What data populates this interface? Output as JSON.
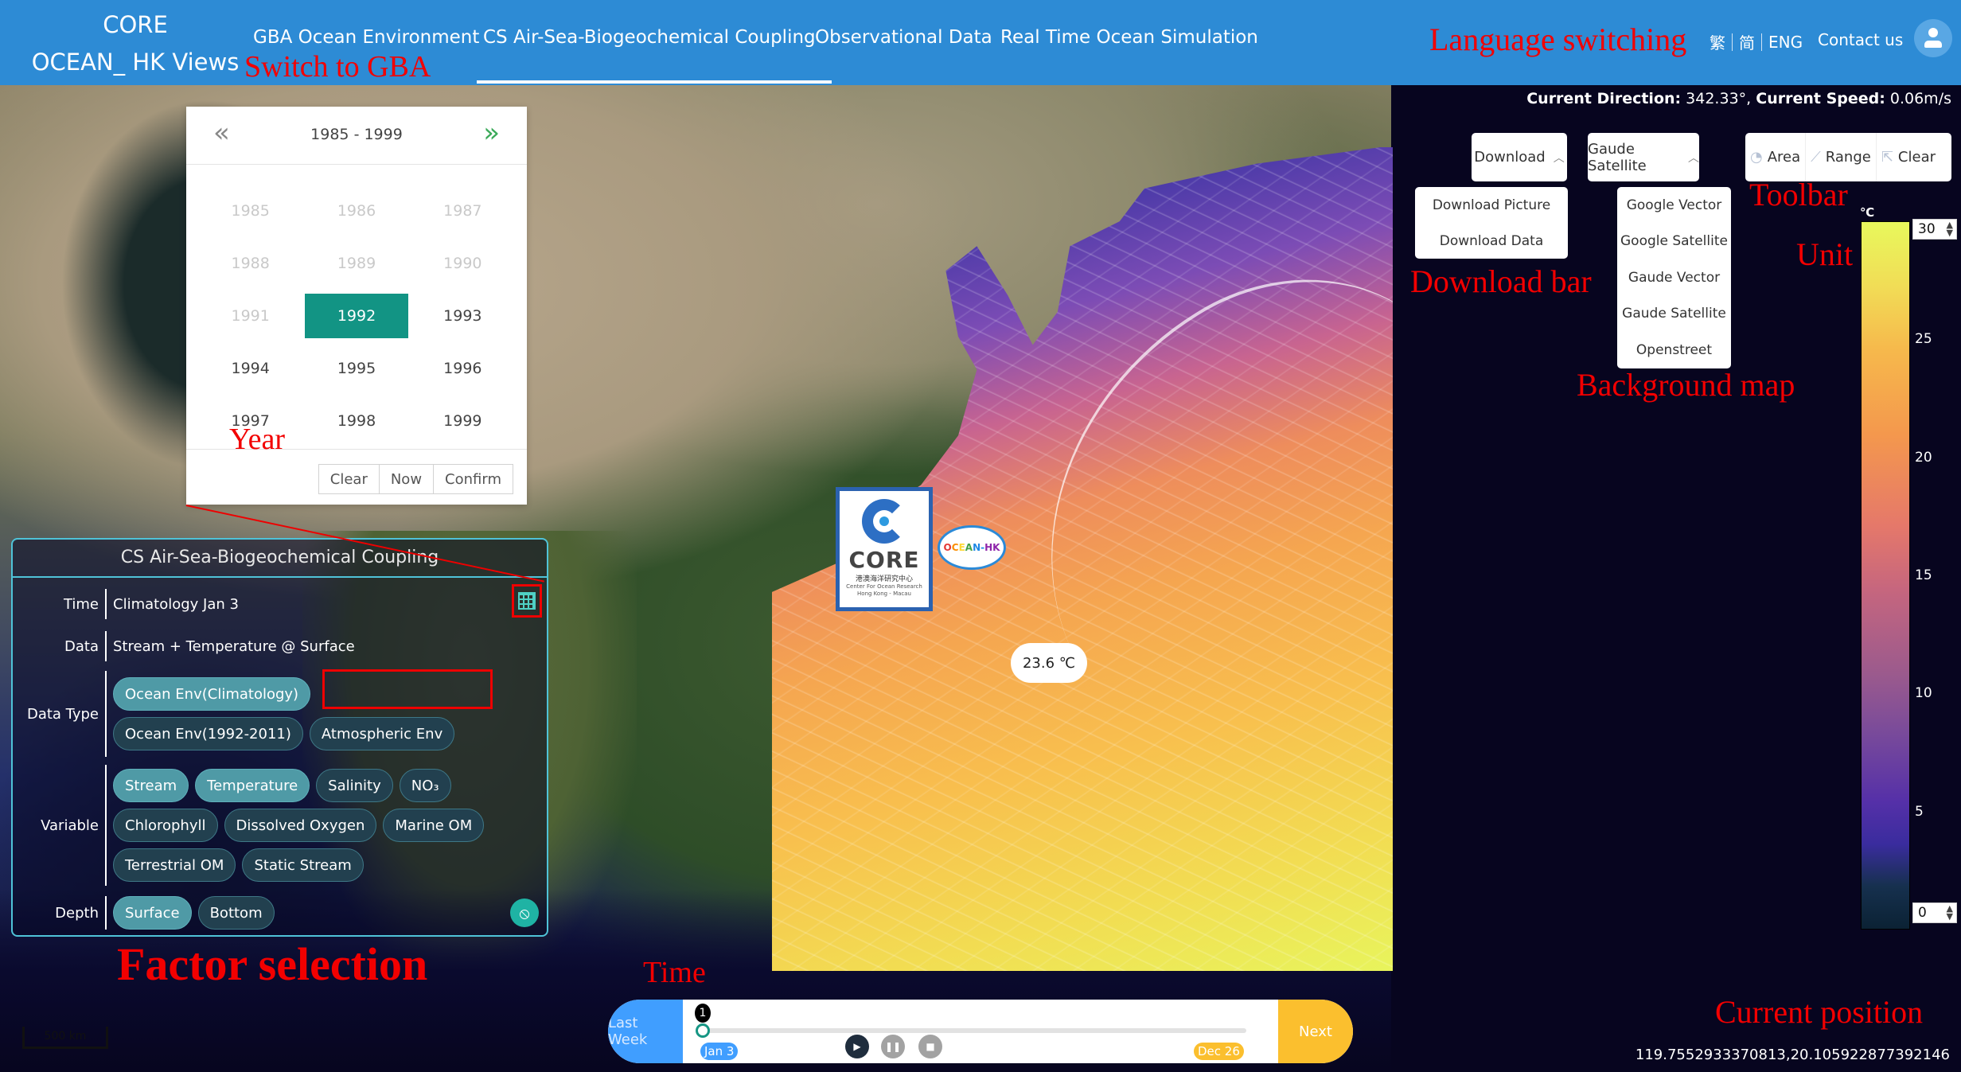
{
  "header": {
    "brand_line1": "CORE",
    "brand_line2": "OCEAN_ HK Views",
    "nav": [
      {
        "label": "GBA Ocean Environment",
        "active": false
      },
      {
        "label": "CS Air-Sea-Biogeochemical Coupling",
        "active": true
      },
      {
        "label": "Observational Data",
        "active": false
      },
      {
        "label": "Real Time Ocean Simulation",
        "active": false
      }
    ],
    "languages": [
      "繁",
      "简",
      "ENG"
    ],
    "contact_label": "Contact us",
    "avatar_icon": "user-icon",
    "brand_color": "#2d8bd5"
  },
  "map": {
    "current_direction_label": "Current Direction:",
    "current_direction_value": "342.33°,",
    "current_speed_label": "Current Speed:",
    "current_speed_value": "0.06m/s",
    "temperature_tooltip": "23.6 ℃",
    "scale_label": "500 km",
    "coordinates": "119.7552933370813,20.105922877392146",
    "logo_core": {
      "mark": "CORE",
      "chinese": "港澳海洋研究中心",
      "english": "Center For Ocean Research",
      "region": "Hong Kong - Macau"
    },
    "logo_ocean_hk": [
      "O",
      "C",
      "E",
      "A",
      "N",
      "-",
      "H",
      "K"
    ]
  },
  "year_picker": {
    "range_label": "1985 - 1999",
    "prev_icon": "double-chevron-left-icon",
    "next_icon": "double-chevron-right-icon",
    "years": [
      {
        "year": "1985",
        "state": "disabled"
      },
      {
        "year": "1986",
        "state": "disabled"
      },
      {
        "year": "1987",
        "state": "disabled"
      },
      {
        "year": "1988",
        "state": "disabled"
      },
      {
        "year": "1989",
        "state": "disabled"
      },
      {
        "year": "1990",
        "state": "disabled"
      },
      {
        "year": "1991",
        "state": "disabled"
      },
      {
        "year": "1992",
        "state": "selected"
      },
      {
        "year": "1993",
        "state": "normal"
      },
      {
        "year": "1994",
        "state": "normal"
      },
      {
        "year": "1995",
        "state": "normal"
      },
      {
        "year": "1996",
        "state": "normal"
      },
      {
        "year": "1997",
        "state": "normal"
      },
      {
        "year": "1998",
        "state": "normal"
      },
      {
        "year": "1999",
        "state": "normal"
      }
    ],
    "buttons": {
      "clear": "Clear",
      "now": "Now",
      "confirm": "Confirm"
    },
    "selected_color": "#129484"
  },
  "factor_panel": {
    "title": "CS Air-Sea-Biogeochemical Coupling",
    "time_label": "Time",
    "time_value": "Climatology Jan 3",
    "data_label": "Data",
    "data_value": "Stream + Temperature @ Surface",
    "data_type_label": "Data Type",
    "data_types": [
      {
        "label": "Ocean Env(Climatology)",
        "selected": true
      },
      {
        "label": "Ocean Env(1992-2011)",
        "selected": false
      },
      {
        "label": "Atmospheric Env",
        "selected": false
      }
    ],
    "variable_label": "Variable",
    "variables": [
      {
        "label": "Stream",
        "selected": true
      },
      {
        "label": "Temperature",
        "selected": true
      },
      {
        "label": "Salinity",
        "selected": false
      },
      {
        "label": "NO₃",
        "selected": false
      },
      {
        "label": "Chlorophyll",
        "selected": false
      },
      {
        "label": "Dissolved Oxygen",
        "selected": false
      },
      {
        "label": "Marine OM",
        "selected": false
      },
      {
        "label": "Terrestrial OM",
        "selected": false
      },
      {
        "label": "Static Stream",
        "selected": false
      }
    ],
    "depth_label": "Depth",
    "depths": [
      {
        "label": "Surface",
        "selected": true
      },
      {
        "label": "Bottom",
        "selected": false
      }
    ],
    "calendar_icon": "calendar-icon",
    "visibility_icon": "eye-off-icon"
  },
  "toolbar": {
    "download_label": "Download",
    "download_options": [
      "Download Picture",
      "Download Data"
    ],
    "basemap_selected": "Gaude Satellite",
    "basemap_options": [
      "Google Vector",
      "Google Satellite",
      "Gaude Vector",
      "Gaude Satellite",
      "Openstreet"
    ],
    "tools": [
      {
        "label": "Area",
        "icon": "area-measure-icon"
      },
      {
        "label": "Range",
        "icon": "ruler-icon"
      },
      {
        "label": "Clear",
        "icon": "clear-export-icon"
      }
    ]
  },
  "colorbar": {
    "unit": "℃",
    "max_value": "30",
    "min_value": "0",
    "ticks": [
      "25",
      "20",
      "15",
      "10",
      "5"
    ],
    "colormap": [
      "#0b2234",
      "#3a2c9e",
      "#7a4b9a",
      "#c6667e",
      "#f4984d",
      "#f6b94c",
      "#e8f85c"
    ]
  },
  "timeline": {
    "prev_label": "Last Week",
    "next_label": "Next",
    "step_badge": "1",
    "start_label": "Jan 3",
    "end_label": "Dec 26",
    "progress": 0,
    "play_icon": "play-icon",
    "pause_icon": "pause-icon",
    "stop_icon": "stop-icon"
  },
  "annotations": {
    "switch_gba": "Switch to GBA",
    "language": "Language switching",
    "year": "Year",
    "factor": "Factor selection",
    "time": "Time",
    "download_bar": "Download bar",
    "background_map": "Background map",
    "toolbar": "Toolbar",
    "unit": "Unit",
    "current_position": "Current position"
  }
}
